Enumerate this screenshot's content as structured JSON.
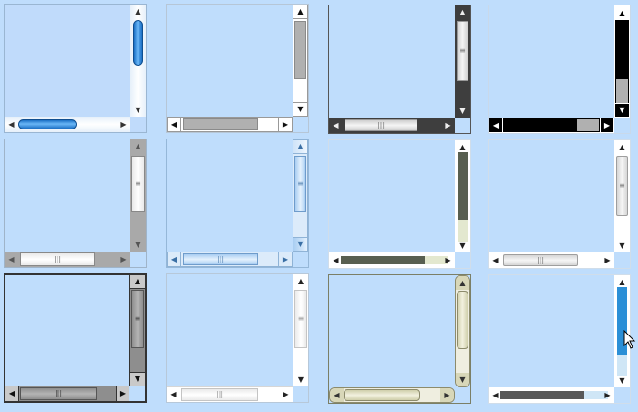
{
  "glyphs": {
    "up": "▲",
    "down": "▼",
    "left": "◀",
    "right": "▶",
    "grip_h": "|||",
    "grip_v": "≡"
  },
  "scrollbars": [
    {
      "style": "aqua",
      "accent": "#3a93e6"
    },
    {
      "style": "gray-classic",
      "accent": "#b0b0b0"
    },
    {
      "style": "dark-frame",
      "accent": "#3e3e3e"
    },
    {
      "style": "high-contrast-black",
      "accent": "#000000"
    },
    {
      "style": "silver",
      "accent": "#a9a9a9"
    },
    {
      "style": "light-blue",
      "accent": "#9cc5ec"
    },
    {
      "style": "olive-dark",
      "accent": "#585f50"
    },
    {
      "style": "white-minimal",
      "accent": "#d6d6d6"
    },
    {
      "style": "dark-gray-frame",
      "accent": "#8e8e8e"
    },
    {
      "style": "white-soft",
      "accent": "#eaeaea"
    },
    {
      "style": "olive-beige",
      "accent": "#d8d7b8"
    },
    {
      "style": "blue-flat-hover",
      "accent": "#2b8fd6"
    }
  ],
  "cursor": {
    "icon": "arrow-pointer-icon"
  }
}
